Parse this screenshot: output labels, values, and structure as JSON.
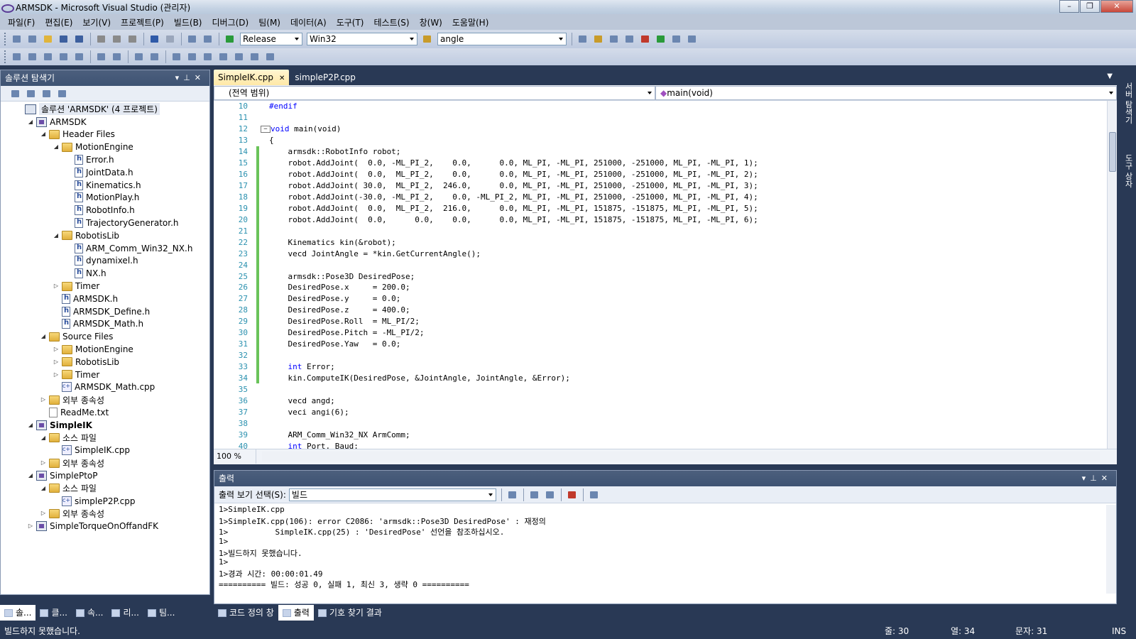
{
  "window": {
    "title": "ARMSDK - Microsoft Visual Studio (관리자)"
  },
  "menu": [
    "파일(F)",
    "편집(E)",
    "보기(V)",
    "프로젝트(P)",
    "빌드(B)",
    "디버그(D)",
    "팀(M)",
    "데이터(A)",
    "도구(T)",
    "테스트(S)",
    "창(W)",
    "도움말(H)"
  ],
  "toolbar": {
    "config": "Release",
    "platform": "Win32",
    "find": "angle"
  },
  "solution_explorer": {
    "title": "솔루션 탐색기",
    "items": [
      {
        "indent": 0,
        "exp": "",
        "icon": "sol",
        "label": "솔루션 'ARMSDK' (4 프로젝트)"
      },
      {
        "indent": 1,
        "exp": "◢",
        "icon": "proj",
        "label": "ARMSDK"
      },
      {
        "indent": 2,
        "exp": "◢",
        "icon": "folder",
        "label": "Header Files"
      },
      {
        "indent": 3,
        "exp": "◢",
        "icon": "folder",
        "label": "MotionEngine"
      },
      {
        "indent": 4,
        "exp": "",
        "icon": "file-h",
        "label": "Error.h"
      },
      {
        "indent": 4,
        "exp": "",
        "icon": "file-h",
        "label": "JointData.h"
      },
      {
        "indent": 4,
        "exp": "",
        "icon": "file-h",
        "label": "Kinematics.h"
      },
      {
        "indent": 4,
        "exp": "",
        "icon": "file-h",
        "label": "MotionPlay.h"
      },
      {
        "indent": 4,
        "exp": "",
        "icon": "file-h",
        "label": "RobotInfo.h"
      },
      {
        "indent": 4,
        "exp": "",
        "icon": "file-h",
        "label": "TrajectoryGenerator.h"
      },
      {
        "indent": 3,
        "exp": "◢",
        "icon": "folder",
        "label": "RobotisLib"
      },
      {
        "indent": 4,
        "exp": "",
        "icon": "file-h",
        "label": "ARM_Comm_Win32_NX.h"
      },
      {
        "indent": 4,
        "exp": "",
        "icon": "file-h",
        "label": "dynamixel.h"
      },
      {
        "indent": 4,
        "exp": "",
        "icon": "file-h",
        "label": "NX.h"
      },
      {
        "indent": 3,
        "exp": "▷",
        "icon": "folder",
        "label": "Timer"
      },
      {
        "indent": 3,
        "exp": "",
        "icon": "file-h",
        "label": "ARMSDK.h"
      },
      {
        "indent": 3,
        "exp": "",
        "icon": "file-h",
        "label": "ARMSDK_Define.h"
      },
      {
        "indent": 3,
        "exp": "",
        "icon": "file-h",
        "label": "ARMSDK_Math.h"
      },
      {
        "indent": 2,
        "exp": "◢",
        "icon": "folder",
        "label": "Source Files"
      },
      {
        "indent": 3,
        "exp": "▷",
        "icon": "folder",
        "label": "MotionEngine"
      },
      {
        "indent": 3,
        "exp": "▷",
        "icon": "folder",
        "label": "RobotisLib"
      },
      {
        "indent": 3,
        "exp": "▷",
        "icon": "folder",
        "label": "Timer"
      },
      {
        "indent": 3,
        "exp": "",
        "icon": "file-cpp",
        "label": "ARMSDK_Math.cpp"
      },
      {
        "indent": 2,
        "exp": "▷",
        "icon": "folder",
        "label": "외부 종속성"
      },
      {
        "indent": 2,
        "exp": "",
        "icon": "file-txt",
        "label": "ReadMe.txt"
      },
      {
        "indent": 1,
        "exp": "◢",
        "icon": "proj",
        "label": "SimpleIK",
        "bold": true
      },
      {
        "indent": 2,
        "exp": "◢",
        "icon": "folder",
        "label": "소스 파일"
      },
      {
        "indent": 3,
        "exp": "",
        "icon": "file-cpp",
        "label": "SimpleIK.cpp"
      },
      {
        "indent": 2,
        "exp": "▷",
        "icon": "folder",
        "label": "외부 종속성"
      },
      {
        "indent": 1,
        "exp": "◢",
        "icon": "proj",
        "label": "SimplePtoP"
      },
      {
        "indent": 2,
        "exp": "◢",
        "icon": "folder",
        "label": "소스 파일"
      },
      {
        "indent": 3,
        "exp": "",
        "icon": "file-cpp",
        "label": "simpleP2P.cpp"
      },
      {
        "indent": 2,
        "exp": "▷",
        "icon": "folder",
        "label": "외부 종속성"
      },
      {
        "indent": 1,
        "exp": "▷",
        "icon": "proj",
        "label": "SimpleTorqueOnOffandFK"
      }
    ]
  },
  "editor": {
    "tabs": [
      {
        "label": "SimpleIK.cpp",
        "active": true
      },
      {
        "label": "simpleP2P.cpp",
        "active": false
      }
    ],
    "scope": "(전역 범위)",
    "member": "main(void)",
    "zoom": "100 %",
    "lines": [
      {
        "n": "10",
        "code": "#endif",
        "kw": true
      },
      {
        "n": "11",
        "code": ""
      },
      {
        "n": "12",
        "code": "void main(void)",
        "fold": true,
        "kwprefix": "void"
      },
      {
        "n": "13",
        "code": "{"
      },
      {
        "n": "14",
        "code": "    armsdk::RobotInfo robot;",
        "mod": true
      },
      {
        "n": "15",
        "code": "    robot.AddJoint(  0.0, -ML_PI_2,    0.0,      0.0, ML_PI, -ML_PI, 251000, -251000, ML_PI, -ML_PI, 1);",
        "mod": true
      },
      {
        "n": "16",
        "code": "    robot.AddJoint(  0.0,  ML_PI_2,    0.0,      0.0, ML_PI, -ML_PI, 251000, -251000, ML_PI, -ML_PI, 2);",
        "mod": true
      },
      {
        "n": "17",
        "code": "    robot.AddJoint( 30.0,  ML_PI_2,  246.0,      0.0, ML_PI, -ML_PI, 251000, -251000, ML_PI, -ML_PI, 3);",
        "mod": true
      },
      {
        "n": "18",
        "code": "    robot.AddJoint(-30.0, -ML_PI_2,    0.0, -ML_PI_2, ML_PI, -ML_PI, 251000, -251000, ML_PI, -ML_PI, 4);",
        "mod": true
      },
      {
        "n": "19",
        "code": "    robot.AddJoint(  0.0,  ML_PI_2,  216.0,      0.0, ML_PI, -ML_PI, 151875, -151875, ML_PI, -ML_PI, 5);",
        "mod": true
      },
      {
        "n": "20",
        "code": "    robot.AddJoint(  0.0,      0.0,    0.0,      0.0, ML_PI, -ML_PI, 151875, -151875, ML_PI, -ML_PI, 6);",
        "mod": true
      },
      {
        "n": "21",
        "code": "",
        "mod": true
      },
      {
        "n": "22",
        "code": "    Kinematics kin(&robot);",
        "mod": true
      },
      {
        "n": "23",
        "code": "    vecd JointAngle = *kin.GetCurrentAngle();",
        "mod": true
      },
      {
        "n": "24",
        "code": "",
        "mod": true
      },
      {
        "n": "25",
        "code": "    armsdk::Pose3D DesiredPose;",
        "mod": true
      },
      {
        "n": "26",
        "code": "    DesiredPose.x     = 200.0;",
        "mod": true
      },
      {
        "n": "27",
        "code": "    DesiredPose.y     = 0.0;",
        "mod": true
      },
      {
        "n": "28",
        "code": "    DesiredPose.z     = 400.0;",
        "mod": true
      },
      {
        "n": "29",
        "code": "    DesiredPose.Roll  = ML_PI/2;",
        "mod": true
      },
      {
        "n": "30",
        "code": "    DesiredPose.Pitch = -ML_PI/2;",
        "mod": true
      },
      {
        "n": "31",
        "code": "    DesiredPose.Yaw   = 0.0;",
        "mod": true
      },
      {
        "n": "32",
        "code": "",
        "mod": true
      },
      {
        "n": "33",
        "code": "    int Error;",
        "mod": true,
        "kwprefix": "    int"
      },
      {
        "n": "34",
        "code": "    kin.ComputeIK(DesiredPose, &JointAngle, JointAngle, &Error);",
        "mod": true
      },
      {
        "n": "35",
        "code": ""
      },
      {
        "n": "36",
        "code": "    vecd angd;"
      },
      {
        "n": "37",
        "code": "    veci angi(6);"
      },
      {
        "n": "38",
        "code": ""
      },
      {
        "n": "39",
        "code": "    ARM_Comm_Win32_NX ArmComm;"
      },
      {
        "n": "40",
        "code": "    int Port, Baud;",
        "kwprefix": "    int"
      }
    ]
  },
  "output": {
    "title": "출력",
    "select_label": "출력 보기 선택(S):",
    "select_value": "빌드",
    "lines": [
      "1>SimpleIK.cpp",
      "1>SimpleIK.cpp(106): error C2086: 'armsdk::Pose3D DesiredPose' : 재정의",
      "1>          SimpleIK.cpp(25) : 'DesiredPose' 선언을 참조하십시오.",
      "1>",
      "1>빌드하지 못했습니다.",
      "1>",
      "1>경과 시간: 00:00:01.49",
      "========== 빌드: 성공 0, 실패 1, 최신 3, 생략 0 =========="
    ]
  },
  "bottom_tabs_left": [
    "솔...",
    "클...",
    "속...",
    "리...",
    "팀..."
  ],
  "bottom_tabs_right": [
    {
      "label": "코드 정의 창"
    },
    {
      "label": "출력",
      "active": true
    },
    {
      "label": "기호 찾기 결과"
    }
  ],
  "status": {
    "message": "빌드하지 못했습니다.",
    "line": "줄: 30",
    "col": "열: 34",
    "char": "문자: 31",
    "mode": "INS"
  },
  "right_strip": [
    "서버 탐색기",
    "도구 상자"
  ]
}
